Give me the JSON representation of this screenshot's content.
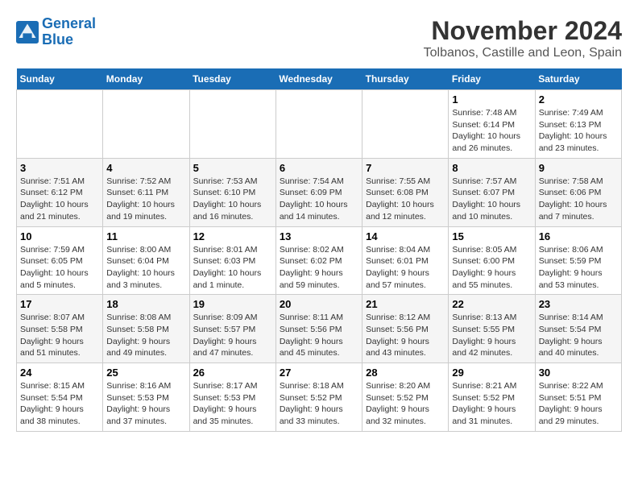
{
  "header": {
    "logo_line1": "General",
    "logo_line2": "Blue",
    "month": "November 2024",
    "location": "Tolbanos, Castille and Leon, Spain"
  },
  "weekdays": [
    "Sunday",
    "Monday",
    "Tuesday",
    "Wednesday",
    "Thursday",
    "Friday",
    "Saturday"
  ],
  "weeks": [
    [
      {
        "day": "",
        "info": ""
      },
      {
        "day": "",
        "info": ""
      },
      {
        "day": "",
        "info": ""
      },
      {
        "day": "",
        "info": ""
      },
      {
        "day": "",
        "info": ""
      },
      {
        "day": "1",
        "info": "Sunrise: 7:48 AM\nSunset: 6:14 PM\nDaylight: 10 hours and 26 minutes."
      },
      {
        "day": "2",
        "info": "Sunrise: 7:49 AM\nSunset: 6:13 PM\nDaylight: 10 hours and 23 minutes."
      }
    ],
    [
      {
        "day": "3",
        "info": "Sunrise: 7:51 AM\nSunset: 6:12 PM\nDaylight: 10 hours and 21 minutes."
      },
      {
        "day": "4",
        "info": "Sunrise: 7:52 AM\nSunset: 6:11 PM\nDaylight: 10 hours and 19 minutes."
      },
      {
        "day": "5",
        "info": "Sunrise: 7:53 AM\nSunset: 6:10 PM\nDaylight: 10 hours and 16 minutes."
      },
      {
        "day": "6",
        "info": "Sunrise: 7:54 AM\nSunset: 6:09 PM\nDaylight: 10 hours and 14 minutes."
      },
      {
        "day": "7",
        "info": "Sunrise: 7:55 AM\nSunset: 6:08 PM\nDaylight: 10 hours and 12 minutes."
      },
      {
        "day": "8",
        "info": "Sunrise: 7:57 AM\nSunset: 6:07 PM\nDaylight: 10 hours and 10 minutes."
      },
      {
        "day": "9",
        "info": "Sunrise: 7:58 AM\nSunset: 6:06 PM\nDaylight: 10 hours and 7 minutes."
      }
    ],
    [
      {
        "day": "10",
        "info": "Sunrise: 7:59 AM\nSunset: 6:05 PM\nDaylight: 10 hours and 5 minutes."
      },
      {
        "day": "11",
        "info": "Sunrise: 8:00 AM\nSunset: 6:04 PM\nDaylight: 10 hours and 3 minutes."
      },
      {
        "day": "12",
        "info": "Sunrise: 8:01 AM\nSunset: 6:03 PM\nDaylight: 10 hours and 1 minute."
      },
      {
        "day": "13",
        "info": "Sunrise: 8:02 AM\nSunset: 6:02 PM\nDaylight: 9 hours and 59 minutes."
      },
      {
        "day": "14",
        "info": "Sunrise: 8:04 AM\nSunset: 6:01 PM\nDaylight: 9 hours and 57 minutes."
      },
      {
        "day": "15",
        "info": "Sunrise: 8:05 AM\nSunset: 6:00 PM\nDaylight: 9 hours and 55 minutes."
      },
      {
        "day": "16",
        "info": "Sunrise: 8:06 AM\nSunset: 5:59 PM\nDaylight: 9 hours and 53 minutes."
      }
    ],
    [
      {
        "day": "17",
        "info": "Sunrise: 8:07 AM\nSunset: 5:58 PM\nDaylight: 9 hours and 51 minutes."
      },
      {
        "day": "18",
        "info": "Sunrise: 8:08 AM\nSunset: 5:58 PM\nDaylight: 9 hours and 49 minutes."
      },
      {
        "day": "19",
        "info": "Sunrise: 8:09 AM\nSunset: 5:57 PM\nDaylight: 9 hours and 47 minutes."
      },
      {
        "day": "20",
        "info": "Sunrise: 8:11 AM\nSunset: 5:56 PM\nDaylight: 9 hours and 45 minutes."
      },
      {
        "day": "21",
        "info": "Sunrise: 8:12 AM\nSunset: 5:56 PM\nDaylight: 9 hours and 43 minutes."
      },
      {
        "day": "22",
        "info": "Sunrise: 8:13 AM\nSunset: 5:55 PM\nDaylight: 9 hours and 42 minutes."
      },
      {
        "day": "23",
        "info": "Sunrise: 8:14 AM\nSunset: 5:54 PM\nDaylight: 9 hours and 40 minutes."
      }
    ],
    [
      {
        "day": "24",
        "info": "Sunrise: 8:15 AM\nSunset: 5:54 PM\nDaylight: 9 hours and 38 minutes."
      },
      {
        "day": "25",
        "info": "Sunrise: 8:16 AM\nSunset: 5:53 PM\nDaylight: 9 hours and 37 minutes."
      },
      {
        "day": "26",
        "info": "Sunrise: 8:17 AM\nSunset: 5:53 PM\nDaylight: 9 hours and 35 minutes."
      },
      {
        "day": "27",
        "info": "Sunrise: 8:18 AM\nSunset: 5:52 PM\nDaylight: 9 hours and 33 minutes."
      },
      {
        "day": "28",
        "info": "Sunrise: 8:20 AM\nSunset: 5:52 PM\nDaylight: 9 hours and 32 minutes."
      },
      {
        "day": "29",
        "info": "Sunrise: 8:21 AM\nSunset: 5:52 PM\nDaylight: 9 hours and 31 minutes."
      },
      {
        "day": "30",
        "info": "Sunrise: 8:22 AM\nSunset: 5:51 PM\nDaylight: 9 hours and 29 minutes."
      }
    ]
  ]
}
